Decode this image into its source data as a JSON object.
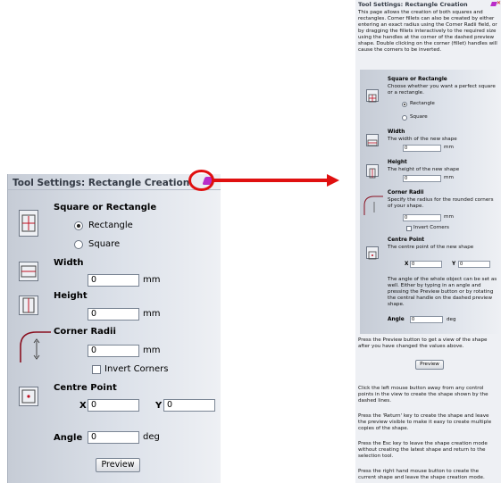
{
  "left_panel": {
    "title": "Tool Settings: Rectangle Creation",
    "square_or_rectangle": {
      "heading": "Square or Rectangle",
      "rectangle_label": "Rectangle",
      "square_label": "Square",
      "selected": "Rectangle"
    },
    "width": {
      "heading": "Width",
      "value": "0",
      "unit": "mm"
    },
    "height": {
      "heading": "Height",
      "value": "0",
      "unit": "mm"
    },
    "corner_radii": {
      "heading": "Corner Radii",
      "value": "0",
      "unit": "mm",
      "invert_label": "Invert Corners"
    },
    "centre_point": {
      "heading": "Centre Point",
      "x_label": "X",
      "x_value": "0",
      "y_label": "Y",
      "y_value": "0"
    },
    "angle": {
      "label": "Angle",
      "value": "0",
      "unit": "deg"
    },
    "preview_button": "Preview"
  },
  "right_panel": {
    "title": "Tool Settings: Rectangle Creation",
    "intro": [
      "This page allows the creation of both squares and",
      "rectangles. Corner fillets can also be created by either",
      "entering an exact radius using the Corner Radii field, or",
      "by dragging the fillets interactively to the required size",
      "using the handles at the corner of the dashed preview",
      "shape. Double clicking on the corner (fillet) handles will",
      "cause the corners to be inverted."
    ],
    "square_or_rectangle": {
      "heading": "Square or Rectangle",
      "desc": [
        "Choose whether you want a perfect square",
        "or a rectangle."
      ],
      "rectangle_label": "Rectangle",
      "square_label": "Square"
    },
    "width": {
      "heading": "Width",
      "desc": "The width of the new shape",
      "value": "0",
      "unit": "mm"
    },
    "height": {
      "heading": "Height",
      "desc": "The height of the new shape",
      "value": "0",
      "unit": "mm"
    },
    "corner_radii": {
      "heading": "Corner Radii",
      "desc": [
        "Specify the radius for the rounded corners",
        "of your shape."
      ],
      "value": "0",
      "unit": "mm",
      "invert_label": "Invert Corners"
    },
    "centre_point": {
      "heading": "Centre Point",
      "desc": "The centre point of the new shape",
      "x_label": "X",
      "x_value": "0",
      "y_label": "Y",
      "y_value": "0"
    },
    "angle_desc": [
      "The angle of the whole object can be set as",
      "well. Either by typing in an angle and",
      "pressing the Preview button or by rotating",
      "the central handle on the dashed preview",
      "shape."
    ],
    "angle": {
      "label": "Angle",
      "value": "0",
      "unit": "deg"
    },
    "preview_note": [
      "Press the Preview button to get a view of the shape",
      "after you have changed the values above."
    ],
    "preview_button": "Preview",
    "help": [
      "Click the left mouse button away from any control",
      "points in the view to create the shape shown by the",
      "dashed lines.",
      "",
      "Press the 'Return' key to create the shape and leave",
      "the preview visible to make it easy to create multiple",
      "copies of the shape.",
      "",
      "Press the Esc key to leave the shape creation mode",
      "without creating the latest shape and return to the",
      "selection tool.",
      "",
      "Press the right hand mouse button to create the",
      "current shape and leave the shape creation mode."
    ]
  },
  "colors": {
    "highlight": "#e01010",
    "pin": "#b92cc9",
    "panel": "#dde2ea"
  }
}
